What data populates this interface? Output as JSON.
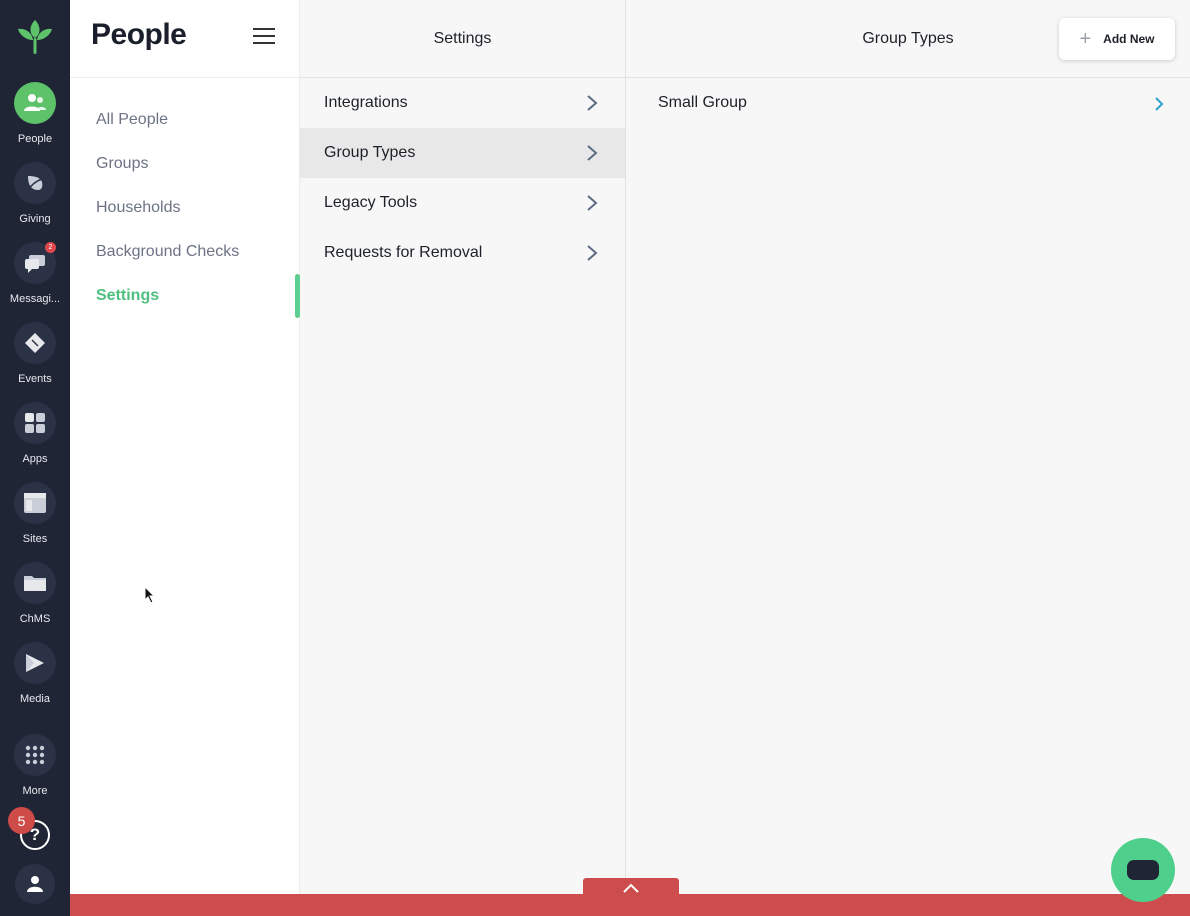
{
  "rail": {
    "logo_icon": "sprout-logo-icon",
    "items": [
      {
        "label": "People",
        "icon": "people-icon",
        "active": true
      },
      {
        "label": "Giving",
        "icon": "leaf-icon"
      },
      {
        "label": "Messagi...",
        "icon": "chat-bubbles-icon",
        "badge": "2"
      },
      {
        "label": "Events",
        "icon": "ticket-icon"
      },
      {
        "label": "Apps",
        "icon": "apps-grid-icon"
      },
      {
        "label": "Sites",
        "icon": "website-icon"
      },
      {
        "label": "ChMS",
        "icon": "folder-icon"
      },
      {
        "label": "Media",
        "icon": "play-icon"
      },
      {
        "label": "More",
        "icon": "dots-grid-icon"
      }
    ],
    "help_badge": "5",
    "help_icon": "question-icon",
    "account_icon": "user-icon"
  },
  "nav": {
    "title": "People",
    "items": [
      {
        "label": "All People"
      },
      {
        "label": "Groups"
      },
      {
        "label": "Households"
      },
      {
        "label": "Background Checks"
      },
      {
        "label": "Settings",
        "active": true
      }
    ]
  },
  "settings": {
    "header": "Settings",
    "rows": [
      {
        "label": "Integrations"
      },
      {
        "label": "Group Types",
        "active": true
      },
      {
        "label": "Legacy Tools"
      },
      {
        "label": "Requests for Removal"
      }
    ]
  },
  "group_types": {
    "header": "Group Types",
    "add_button": "Add New",
    "rows": [
      {
        "label": "Small Group"
      }
    ]
  },
  "colors": {
    "rail_bg": "#1f2535",
    "accent_green": "#4fbf7f",
    "bottom_bar": "#cd4d4e",
    "chat_button": "#4fcf8c",
    "type_chevron": "#2ea3c8"
  }
}
